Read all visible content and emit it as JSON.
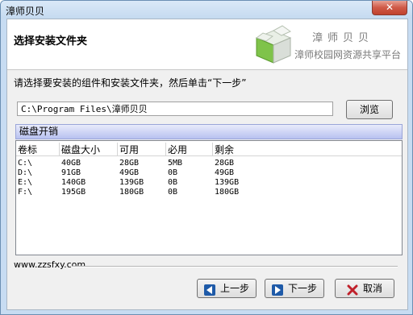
{
  "window": {
    "title": "漳师贝贝",
    "close_label": "✕"
  },
  "header": {
    "title": "选择安装文件夹",
    "brand_name": "漳师贝贝",
    "brand_slogan": "漳师校园网资源共享平台"
  },
  "instruction": "请选择要安装的组件和安装文件夹，然后单击“下一步”",
  "install_path": {
    "value": "C:\\Program Files\\漳师贝贝"
  },
  "browse_label": "浏览",
  "disk_panel": {
    "title": "磁盘开销",
    "columns": [
      "卷标",
      "磁盘大小",
      "可用",
      "必用",
      "剩余"
    ],
    "rows": [
      [
        "C:\\",
        "40GB",
        "28GB",
        "5MB",
        "28GB"
      ],
      [
        "D:\\",
        "91GB",
        "49GB",
        "0B",
        "49GB"
      ],
      [
        "E:\\",
        "140GB",
        "139GB",
        "0B",
        "139GB"
      ],
      [
        "F:\\",
        "195GB",
        "180GB",
        "0B",
        "180GB"
      ]
    ]
  },
  "footer": {
    "url": "www.zzsfxy.com"
  },
  "buttons": {
    "back": "上一步",
    "next": "下一步",
    "cancel": "取消"
  },
  "icons": {
    "logo": "box-icon",
    "back": "arrow-left-icon",
    "next": "arrow-right-icon",
    "cancel": "cross-icon"
  },
  "colors": {
    "title_bg": "#c5daf0",
    "close_bg": "#c0412d",
    "panel_header": "#b8c1f0",
    "nav_icon": "#1e5aa8",
    "cancel_icon": "#c0212b"
  }
}
